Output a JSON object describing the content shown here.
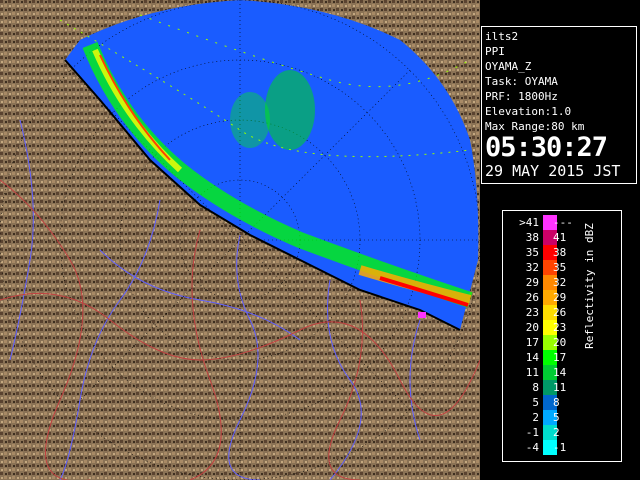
{
  "info": {
    "product": "ilts2",
    "mode": "PPI",
    "field": "OYAMA_Z",
    "task": "Task: OYAMA",
    "prf": "PRF: 1800Hz",
    "elevation": "Elevation:1.0",
    "max_range": "Max Range:80 km",
    "time": "05:30:27",
    "date": "29 MAY 2015 JST"
  },
  "legend": {
    "title": "Reflectivity in dBZ",
    "rows": [
      {
        "lo": ">41",
        "hi": "---",
        "color": "#ff33ff"
      },
      {
        "lo": "38",
        "hi": "41",
        "color": "#cc0066"
      },
      {
        "lo": "35",
        "hi": "38",
        "color": "#ff0000"
      },
      {
        "lo": "32",
        "hi": "35",
        "color": "#ff4400"
      },
      {
        "lo": "29",
        "hi": "32",
        "color": "#ff8800"
      },
      {
        "lo": "26",
        "hi": "29",
        "color": "#ffaa00"
      },
      {
        "lo": "23",
        "hi": "26",
        "color": "#ffdd00"
      },
      {
        "lo": "20",
        "hi": "23",
        "color": "#ffff00"
      },
      {
        "lo": "17",
        "hi": "20",
        "color": "#99ff00"
      },
      {
        "lo": "14",
        "hi": "17",
        "color": "#00ff00"
      },
      {
        "lo": "11",
        "hi": "14",
        "color": "#00cc33"
      },
      {
        "lo": "8",
        "hi": "11",
        "color": "#009966"
      },
      {
        "lo": "5",
        "hi": "8",
        "color": "#0066cc"
      },
      {
        "lo": "2",
        "hi": "5",
        "color": "#00aaff"
      },
      {
        "lo": "-1",
        "hi": "2",
        "color": "#00ddcc"
      },
      {
        "lo": "-4",
        "hi": "-1",
        "color": "#00ffff"
      }
    ]
  },
  "colors": {
    "sea": "#1a5cff",
    "land": "#8a7255",
    "rivers": "#6060ff",
    "borders": "#c04040",
    "coast": "#000000"
  }
}
